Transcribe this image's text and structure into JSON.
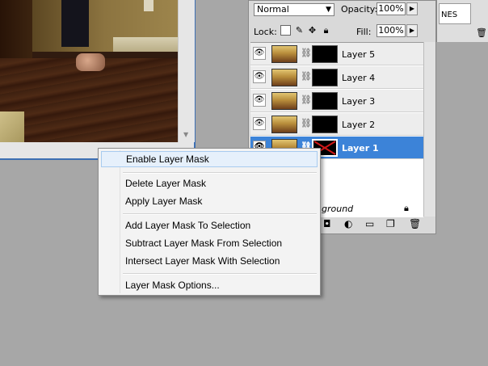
{
  "layers_panel": {
    "blend_mode": "Normal",
    "opacity_label": "Opacity:",
    "opacity_value": "100%",
    "lock_label": "Lock:",
    "fill_label": "Fill:",
    "fill_value": "100%",
    "layers": [
      {
        "name": "Layer 5",
        "selected": false
      },
      {
        "name": "Layer 4",
        "selected": false
      },
      {
        "name": "Layer 3",
        "selected": false
      },
      {
        "name": "Layer 2",
        "selected": false
      },
      {
        "name": "Layer 1",
        "selected": true
      }
    ],
    "background_layer": "ground"
  },
  "right_fragment": {
    "text": "NES"
  },
  "context_menu": {
    "items": [
      {
        "label": "Enable Layer Mask",
        "hover": true
      },
      {
        "label": "Delete Layer Mask"
      },
      {
        "label": "Apply Layer Mask"
      },
      {
        "label": "Add Layer Mask To Selection"
      },
      {
        "label": "Subtract Layer Mask From Selection"
      },
      {
        "label": "Intersect Layer Mask With Selection"
      },
      {
        "label": "Layer Mask Options..."
      }
    ]
  },
  "colors": {
    "selection": "#3c83d8",
    "mask_x": "#d01818"
  }
}
